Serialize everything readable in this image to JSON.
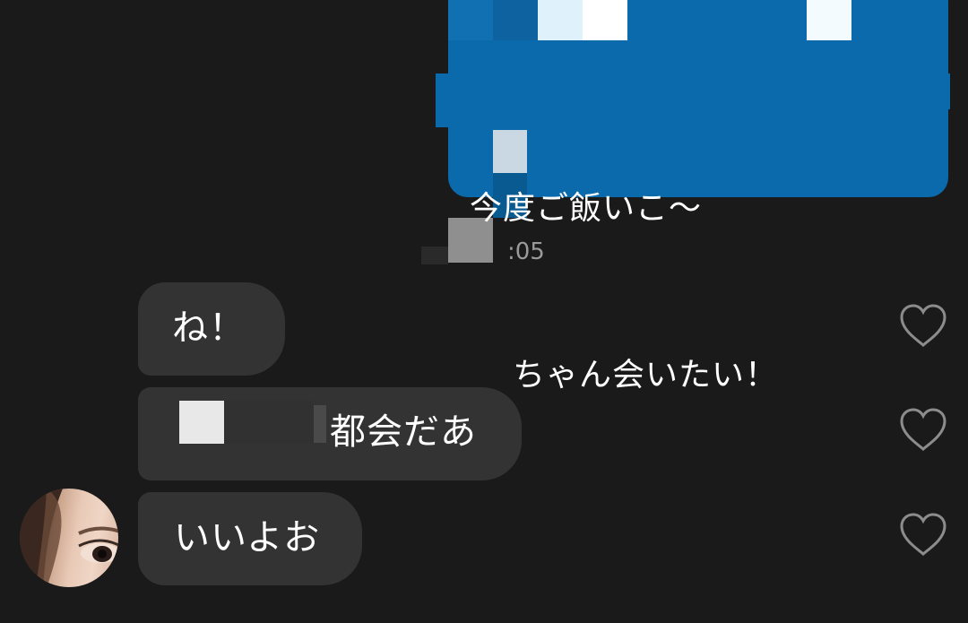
{
  "sent_message": {
    "line1": "今度ご飯いこ〜",
    "line2": "ちゃん会いたい！",
    "timestamp": ":05"
  },
  "received_messages": [
    {
      "text": "ね！"
    },
    {
      "text": "都会だあ"
    },
    {
      "text": "いいよお"
    }
  ],
  "colors": {
    "background": "#1a1a1a",
    "sent_bubble": "#0b6aab",
    "received_bubble": "#333333",
    "timestamp": "#9a9a9a",
    "heart_outline": "#8c8c8c"
  },
  "icons": [
    "heart-outline-icon",
    "avatar"
  ]
}
